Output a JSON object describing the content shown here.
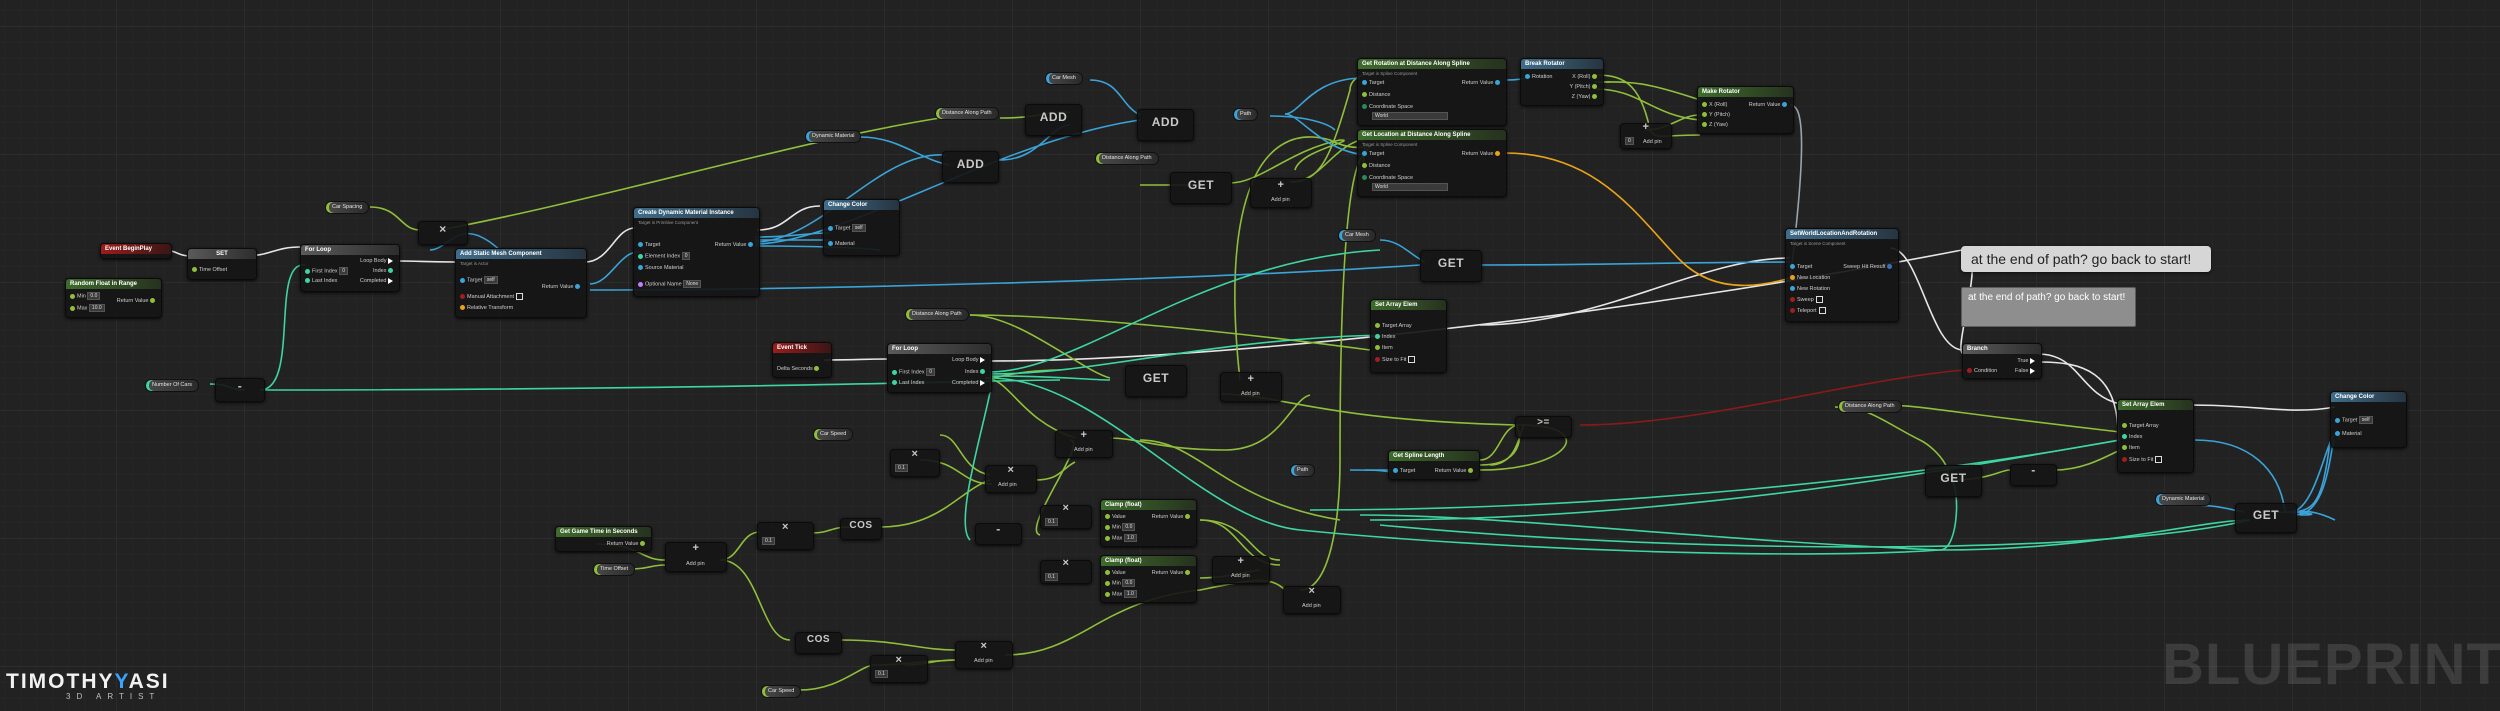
{
  "nodes": {
    "event_beginplay": "Event BeginPlay",
    "set": "SET",
    "time_offset": "Time Offset",
    "random_float": "Random Float in Range",
    "min": "Min",
    "max": "Max",
    "min_val": "0.0",
    "max_val": "10.0",
    "return_value": "Return Value",
    "for_loop": "For Loop",
    "loop_body": "Loop Body",
    "first_index": "First Index",
    "last_index": "Last Index",
    "index": "Index",
    "completed": "Completed",
    "add_static_mesh": "Add Static Mesh Component",
    "add_static_mesh_sub": "Target is Actor",
    "target": "Target",
    "target_self": "self",
    "manual_attachment": "Manual Attachment",
    "relative_transform": "Relative Transform",
    "create_dmi": "Create Dynamic Material Instance",
    "create_dmi_sub": "Target is Primitive Component",
    "element_index": "Element Index",
    "source_material": "Source Material",
    "optional_name": "Optional Name",
    "element_index_val": "0",
    "optional_name_val": "None",
    "change_color": "Change Color",
    "material": "Material",
    "add": "ADD",
    "get": "GET",
    "cos": "COS",
    "number_of_cars": "Number Of Cars",
    "car_spacing": "Car Spacing",
    "car_mesh": "Car Mesh",
    "dynamic_material": "Dynamic Material",
    "distance_along_path": "Distance Along Path",
    "path": "Path",
    "car_speed": "Car Speed",
    "time_offset_var": "Time Offset",
    "event_tick": "Event Tick",
    "delta_seconds": "Delta Seconds",
    "get_rot_spline": "Get Rotation at Distance Along Spline",
    "get_loc_spline": "Get Location at Distance Along Spline",
    "spline_sub": "Target is Spline Component",
    "distance": "Distance",
    "coordinate_space": "Coordinate Space",
    "coordinate_space_val": "World",
    "break_rotator": "Break Rotator",
    "rotation": "Rotation",
    "x_roll": "X (Roll)",
    "y_pitch": "Y (Pitch)",
    "z_yaw": "Z (Yaw)",
    "make_rotator": "Make Rotator",
    "add_pin": "Add pin",
    "set_actor_loc_rot": "SetWorldLocationAndRotation",
    "set_actor_loc_rot_sub": "Target is Scene Component",
    "new_location": "New Location",
    "new_rotation": "New Rotation",
    "sweep": "Sweep",
    "teleport": "Teleport",
    "sweep_hit_result": "Sweep Hit Result",
    "set_array_elem": "Set Array Elem",
    "target_array": "Target Array",
    "item": "Item",
    "size_to_fit": "Size to Fit",
    "get_spline_length": "Get Spline Length",
    "branch": "Branch",
    "condition": "Condition",
    "true": "True",
    "false": "False",
    "greater_eq": ">=",
    "get_game_time": "Get Game Time in Seconds",
    "clamp_float": "Clamp (float)",
    "value": "Value",
    "clamp_min": "0.0",
    "clamp_max": "1.0",
    "const_val": "0.1",
    "zero": "0"
  },
  "comment": {
    "bubble": "at the end of path? go back to start!",
    "edit": "at the end of path? go back to start!"
  },
  "branding": {
    "name_left": "TIMOTHY",
    "name_right": "ASI",
    "subtitle": "3D ARTIST",
    "watermark": "BLUEPRINT"
  },
  "colors": {
    "exec": "#ffffff",
    "float": "#8fbf3a",
    "object": "#3aa3d8",
    "int": "#3ed6a0",
    "bool": "#a11e1e",
    "struct": "#e8a317"
  }
}
